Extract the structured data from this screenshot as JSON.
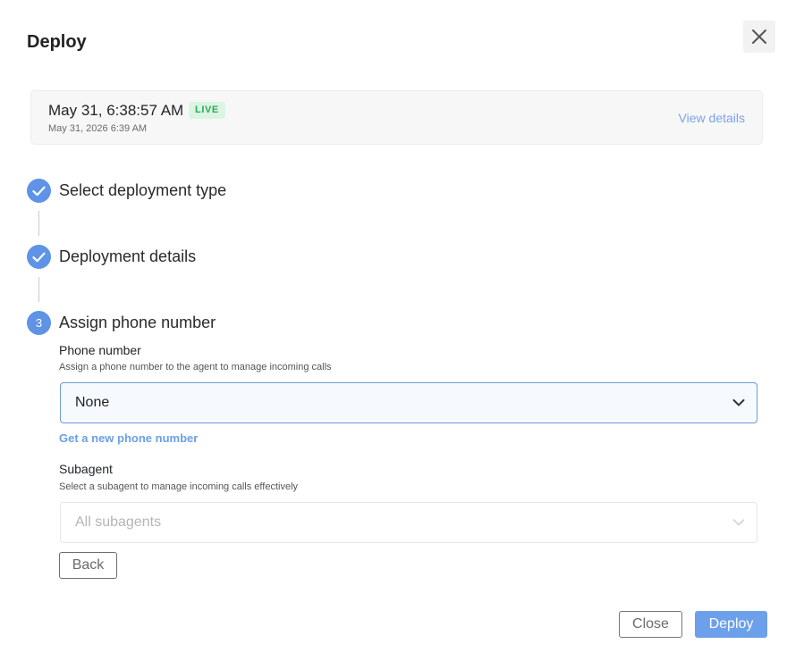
{
  "dialog": {
    "title": "Deploy"
  },
  "version": {
    "time": "May 31, 6:38:57 AM",
    "badge": "LIVE",
    "date": "May 31, 2026 6:39 AM",
    "view_details": "View details"
  },
  "steps": [
    {
      "status": "complete",
      "number": "",
      "label": "Select deployment type"
    },
    {
      "status": "complete",
      "number": "",
      "label": "Deployment details"
    },
    {
      "status": "current",
      "number": "3",
      "label": "Assign phone number"
    }
  ],
  "phone_number": {
    "label": "Phone number",
    "help": "Assign a phone number to the agent to manage incoming calls",
    "selected": "None",
    "link": "Get a new phone number"
  },
  "subagent": {
    "label": "Subagent",
    "help": "Select a subagent to manage incoming calls effectively",
    "selected": "All subagents",
    "disabled": true
  },
  "buttons": {
    "back": "Back",
    "close": "Close",
    "deploy": "Deploy"
  },
  "colors": {
    "accent": "#5e93e6",
    "live_bg": "#dcf5e3",
    "live_text": "#2fa75a",
    "link": "#6a9fe6"
  },
  "icons": {
    "close": "close-icon",
    "check": "check-icon",
    "chevron": "chevron-down-icon"
  }
}
